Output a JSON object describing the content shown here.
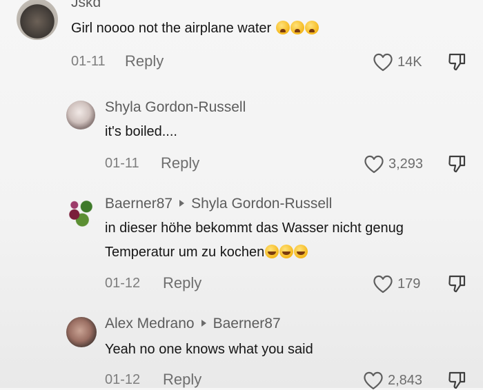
{
  "comments": [
    {
      "user": "Jskd",
      "reply_to": "",
      "text": "Girl noooo not the airplane water",
      "emojis": [
        "weary",
        "weary",
        "weary"
      ],
      "date": "01-11",
      "reply_label": "Reply",
      "likes": "14K"
    },
    {
      "user": "Shyla Gordon-Russell",
      "reply_to": "",
      "text": "it's boiled....",
      "emojis": [],
      "date": "01-11",
      "reply_label": "Reply",
      "likes": "3,293"
    },
    {
      "user": "Baerner87",
      "reply_to": "Shyla Gordon-Russell",
      "text": "in dieser höhe bekommt das Wasser nicht genug",
      "text2": "Temperatur um zu kochen",
      "emojis": [
        "laugh",
        "laugh",
        "laugh"
      ],
      "date": "01-12",
      "reply_label": "Reply",
      "likes": "179"
    },
    {
      "user": "Alex Medrano",
      "reply_to": "Baerner87",
      "text": "Yeah no one knows what you said",
      "emojis": [],
      "date": "01-12",
      "reply_label": "Reply",
      "likes": "2,843"
    }
  ],
  "icons": {
    "like": "heart-outline-icon",
    "dislike": "thumbs-down-outline-icon",
    "arrow": "reply-arrow-icon"
  }
}
